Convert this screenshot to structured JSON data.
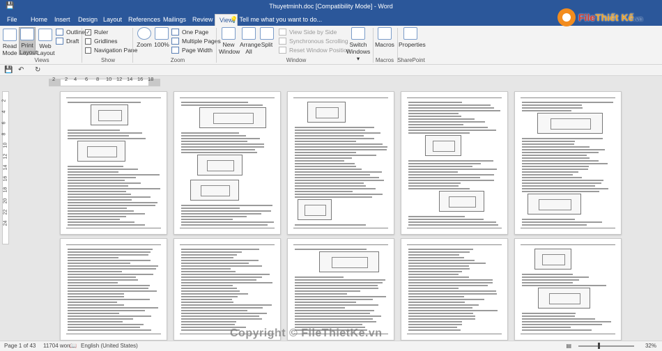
{
  "window": {
    "title": "Thuyetminh.doc [Compatibility Mode] - Word"
  },
  "brand": {
    "name_a": "File",
    "name_b": "Thiết Kế",
    "suffix": ".vn"
  },
  "tabs": [
    "File",
    "Home",
    "Insert",
    "Design",
    "Layout",
    "References",
    "Mailings",
    "Review",
    "View"
  ],
  "active_tab": "View",
  "tell_me": "Tell me what you want to do...",
  "ribbon": {
    "views": {
      "label": "Views",
      "read_mode": "Read Mode",
      "print_layout": "Print Layout",
      "web_layout": "Web Layout",
      "outline": "Outline",
      "draft": "Draft"
    },
    "show": {
      "label": "Show",
      "ruler": "Ruler",
      "gridlines": "Gridlines",
      "navigation_pane": "Navigation Pane",
      "ruler_checked": true
    },
    "zoom": {
      "label": "Zoom",
      "zoom": "Zoom",
      "hundred": "100%",
      "one_page": "One Page",
      "multiple_pages": "Multiple Pages",
      "page_width": "Page Width"
    },
    "window": {
      "label": "Window",
      "new_window": "New Window",
      "arrange_all": "Arrange All",
      "split": "Split",
      "view_side_by_side": "View Side by Side",
      "synchronous_scrolling": "Synchronous Scrolling",
      "reset_window_position": "Reset Window Position",
      "switch_windows": "Switch Windows"
    },
    "macros": {
      "label": "Macros",
      "macros": "Macros"
    },
    "sharepoint": {
      "label": "SharePoint",
      "properties": "Properties"
    }
  },
  "ruler": {
    "numbers": [
      "2",
      "2",
      "4",
      "6",
      "8",
      "10",
      "12",
      "14",
      "16",
      "18"
    ]
  },
  "vruler": {
    "numbers": [
      "2",
      "4",
      "6",
      "8",
      "10",
      "12",
      "14",
      "16",
      "18",
      "20",
      "22",
      "24"
    ]
  },
  "statusbar": {
    "page": "Page 1 of 43",
    "words": "11704 words",
    "language": "English (United States)",
    "zoom": "32%"
  },
  "watermark": "Copyright © FileThietKe.vn",
  "colors": {
    "accent": "#2b579a",
    "brand_orange": "#f28c1e",
    "brand_red": "#d93a2b"
  }
}
